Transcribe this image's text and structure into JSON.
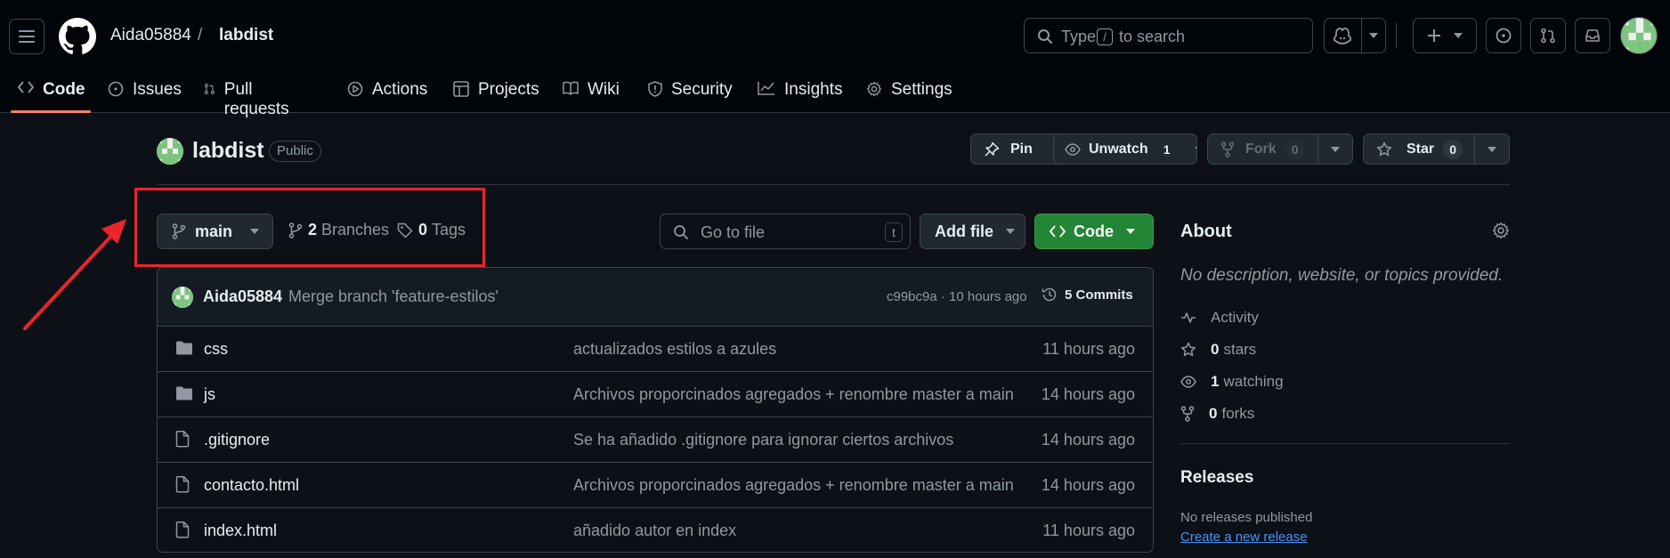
{
  "header": {
    "owner": "Aida05884",
    "separator": "/",
    "repo": "labdist",
    "search": {
      "text_before": "Type",
      "shortcut": "/",
      "text_after": "to search"
    }
  },
  "nav": {
    "tabs": [
      {
        "label": "Code",
        "icon": "code-icon",
        "active": true
      },
      {
        "label": "Issues",
        "icon": "issue-opened-icon"
      },
      {
        "label": "Pull requests",
        "icon": "git-pull-request-icon"
      },
      {
        "label": "Actions",
        "icon": "play-icon"
      },
      {
        "label": "Projects",
        "icon": "table-icon"
      },
      {
        "label": "Wiki",
        "icon": "book-icon"
      },
      {
        "label": "Security",
        "icon": "shield-icon"
      },
      {
        "label": "Insights",
        "icon": "graph-icon"
      },
      {
        "label": "Settings",
        "icon": "gear-icon"
      }
    ]
  },
  "repo": {
    "name": "labdist",
    "visibility": "Public",
    "pin_label": "Pin",
    "watch_label": "Unwatch",
    "watch_count": "1",
    "fork_label": "Fork",
    "fork_count": "0",
    "star_label": "Star",
    "star_count": "0"
  },
  "controls": {
    "branch": "main",
    "branches_count": "2",
    "branches_label": "Branches",
    "tags_count": "0",
    "tags_label": "Tags",
    "goto_placeholder": "Go to file",
    "goto_shortcut": "t",
    "add_file_label": "Add file",
    "code_label": "Code"
  },
  "latest_commit": {
    "author": "Aida05884",
    "message": "Merge branch 'feature-estilos'",
    "meta": "c99bc9a · 10 hours ago",
    "commits_label": "5 Commits"
  },
  "files": [
    {
      "name": "css",
      "type": "folder",
      "message": "actualizados estilos a azules",
      "time": "11 hours ago"
    },
    {
      "name": "js",
      "type": "folder",
      "message": "Archivos proporcinados agregados + renombre master a main",
      "time": "14 hours ago"
    },
    {
      "name": ".gitignore",
      "type": "file",
      "message": "Se ha añadido .gitignore para ignorar ciertos archivos",
      "time": "14 hours ago"
    },
    {
      "name": "contacto.html",
      "type": "file",
      "message": "Archivos proporcinados agregados + renombre master a main",
      "time": "14 hours ago"
    },
    {
      "name": "index.html",
      "type": "file",
      "message": "añadido autor en index",
      "time": "11 hours ago"
    }
  ],
  "about": {
    "title": "About",
    "description": "No description, website, or topics provided.",
    "activity_label": "Activity",
    "stars_count": "0",
    "stars_label": "stars",
    "watching_count": "1",
    "watching_label": "watching",
    "forks_count": "0",
    "forks_label": "forks"
  },
  "releases": {
    "title": "Releases",
    "none_text": "No releases published",
    "create_link": "Create a new release"
  },
  "colors": {
    "background": "#0d1117",
    "accent_green": "#238636",
    "link_blue": "#4493f8",
    "highlight_red": "#e8262b",
    "tab_underline": "#f78166"
  }
}
